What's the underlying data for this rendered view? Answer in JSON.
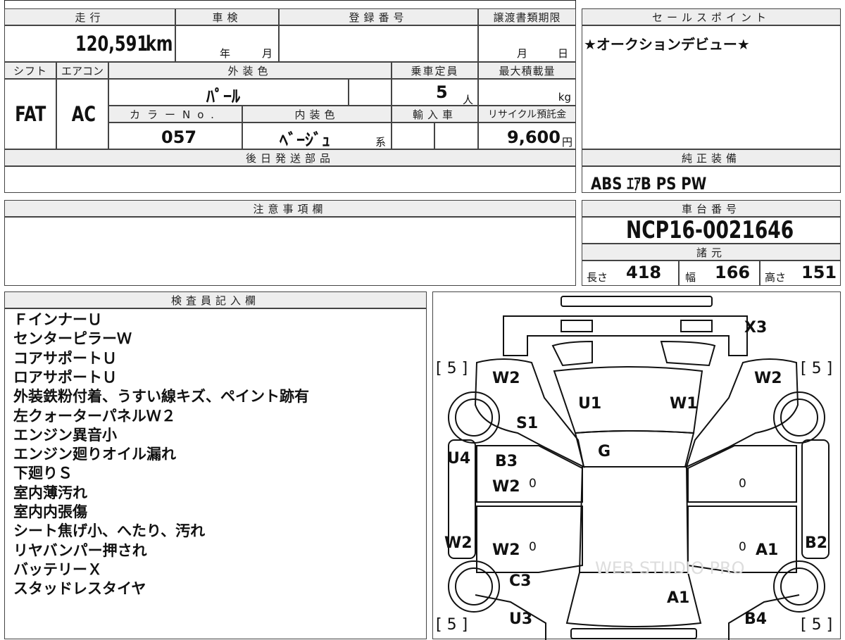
{
  "header": {
    "mileage_label": "走行",
    "mileage_value": "120,591",
    "mileage_unit": "km",
    "inspection_label": "車検",
    "inspection_year_unit": "年",
    "inspection_month_unit": "月",
    "registration_label": "登録番号",
    "transfer_deadline_label": "譲渡書類期限",
    "transfer_month_unit": "月",
    "transfer_day_unit": "日"
  },
  "specs": {
    "shift_label": "シフト",
    "shift_value": "FAT",
    "ac_label": "エアコン",
    "ac_value": "AC",
    "exterior_color_label": "外装色",
    "exterior_color_value": "ﾊﾟｰﾙ",
    "capacity_label": "乗車定員",
    "capacity_value": "5",
    "capacity_unit": "人",
    "max_load_label": "最大積載量",
    "max_load_unit": "kg",
    "color_no_label": "カラーNo.",
    "color_no_value": "057",
    "interior_color_label": "内装色",
    "interior_color_value": "ﾍﾞｰｼﾞｭ",
    "interior_color_suffix": "系",
    "import_label": "輸入車",
    "recycle_label": "リサイクル預託金",
    "recycle_value": "9,600",
    "recycle_unit": "円"
  },
  "later_parts_label": "後日発送部品",
  "notes_label": "注意事項欄",
  "sales_point": {
    "label": "セールスポイント",
    "text": "★オークションデビュー★"
  },
  "equipment": {
    "label": "純正装備",
    "text": "ABS ｴｱB PS PW"
  },
  "chassis": {
    "label": "車台番号",
    "value": "NCP16-0021646"
  },
  "dimensions": {
    "label": "諸元",
    "length_label": "長さ",
    "length_value": "418",
    "width_label": "幅",
    "width_value": "166",
    "height_label": "高さ",
    "height_value": "151"
  },
  "inspector": {
    "label": "検査員記入欄",
    "notes": [
      "ＦインナーＵ",
      "センターピラーＷ",
      "コアサポートＵ",
      "ロアサポートＵ",
      "外装鉄粉付着、うすい線キズ、ペイント跡有",
      "左クォーターパネルＷ２",
      "エンジン異音小",
      "エンジン廻りオイル漏れ",
      "下廻りＳ",
      "室内薄汚れ",
      "室内内張傷",
      "シート焦げ小、へたり、汚れ",
      "リヤバンパー押され",
      "バッテリーＸ",
      "スタッドレスタイヤ"
    ]
  },
  "diagram": {
    "tire_labels": [
      "[ 5 ]",
      "[ 5 ]",
      "[ 5 ]",
      "[ 5 ]"
    ],
    "codes": {
      "roof_front": "X3",
      "front_left_fender": "W2",
      "front_right_fender": "W2",
      "hood_left": "U1",
      "hood_right": "W1",
      "left_s": "S1",
      "windshield": "G",
      "left_side_u": "U4",
      "front_left_door_b": "B3",
      "front_left_door_w": "W2",
      "rear_left_door_w": "W2",
      "left_rear_w": "W2",
      "left_quarter_c": "C3",
      "rear_bumper_left": "U3",
      "trunk": "A1",
      "rear_right_door": "A1",
      "right_side_b": "B2",
      "rear_right_b": "B4",
      "zero_mark": "0"
    },
    "watermark": "WEB STUDIO PRO"
  }
}
